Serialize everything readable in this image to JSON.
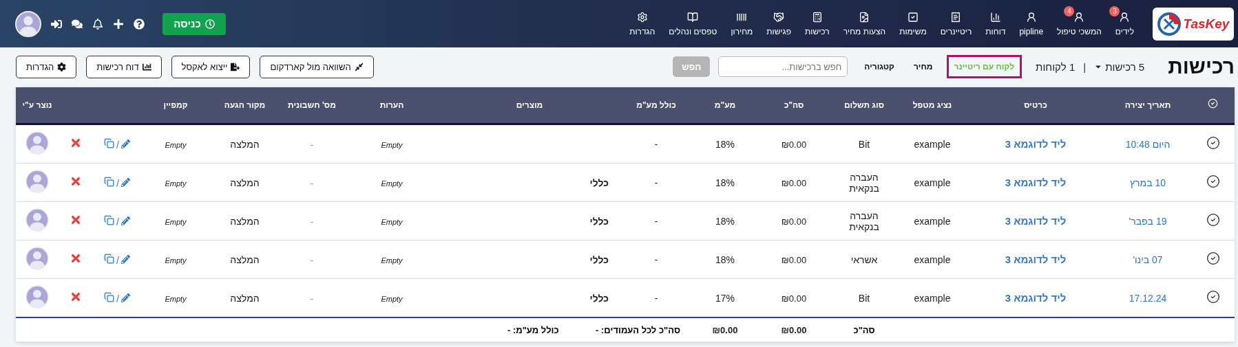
{
  "header": {
    "logo": {
      "text": "TasKey"
    },
    "nav": [
      {
        "label": "לידים",
        "badge": "3"
      },
      {
        "label": "המשכי טיפול",
        "badge": "4"
      },
      {
        "label": "pipline"
      },
      {
        "label": "דוחות"
      },
      {
        "label": "ריטיינרים"
      },
      {
        "label": "משימות"
      },
      {
        "label": "הצעות מחיר"
      },
      {
        "label": "רכישות"
      },
      {
        "label": "פגישות"
      },
      {
        "label": "מחירון"
      },
      {
        "label": "טפסים ונהלים"
      },
      {
        "label": "הגדרות"
      }
    ],
    "checkin_button": {
      "label": "כניסה"
    }
  },
  "page": {
    "title": "רכישות",
    "purchases_count": "5 רכישות",
    "separator": "|",
    "clients_count": "1 לקוחות",
    "filters": [
      {
        "label": "לקוח עם ריטיינר",
        "selected": true
      },
      {
        "label": "מחיר",
        "selected": false
      },
      {
        "label": "קטגוריה",
        "selected": false
      }
    ],
    "search": {
      "placeholder": "חפש ברכישות...",
      "button": "חפש",
      "button_disabled": true
    },
    "actions": [
      {
        "label": "השוואה מול קארדקום"
      },
      {
        "label": "ייצוא לאקסל"
      },
      {
        "label": "דוח רכישות"
      },
      {
        "label": "הגדרות"
      }
    ]
  },
  "table": {
    "columns": [
      {
        "kind": "select"
      },
      {
        "kind": "text",
        "label": "תאריך יצירה"
      },
      {
        "kind": "text",
        "label": "כרטיס"
      },
      {
        "kind": "text",
        "label": "נציג מטפל"
      },
      {
        "kind": "text",
        "label": "סוג תשלום"
      },
      {
        "kind": "text",
        "label": "סה\"כ"
      },
      {
        "kind": "text",
        "label": "מע\"מ"
      },
      {
        "kind": "text",
        "label": "כולל מע\"מ"
      },
      {
        "kind": "text",
        "label": "מוצרים"
      },
      {
        "kind": "text",
        "label": "הערות"
      },
      {
        "kind": "text",
        "label": "מס' חשבונית"
      },
      {
        "kind": "text",
        "label": "מקור הגעה"
      },
      {
        "kind": "text",
        "label": "קמפיין"
      },
      {
        "kind": "blank"
      },
      {
        "kind": "blank"
      },
      {
        "kind": "text",
        "label": "נוצר ע\"י"
      }
    ],
    "rows": [
      {
        "date": "היום 10:48",
        "card": "ליד לדוגמא 3",
        "rep": "example",
        "payment": "Bit",
        "total": "₪0.00",
        "vat": "18%",
        "incl": "-",
        "notes": "Empty",
        "invoice": "-",
        "source": "המלצה",
        "campaign": "Empty",
        "separator": "/"
      },
      {
        "date": "10 במרץ",
        "card": "ליד לדוגמא 3",
        "rep": "example",
        "payment": "העברה בנקאית",
        "total": "₪0.00",
        "vat": "18%",
        "incl": "-",
        "products": "כללי",
        "notes": "Empty",
        "invoice": "-",
        "source": "המלצה",
        "campaign": "Empty",
        "separator": "/"
      },
      {
        "date": "19 בפבר'",
        "card": "ליד לדוגמא 3",
        "rep": "example",
        "payment": "העברה בנקאית",
        "total": "₪0.00",
        "vat": "18%",
        "incl": "-",
        "products": "כללי",
        "notes": "Empty",
        "invoice": "-",
        "source": "המלצה",
        "campaign": "Empty",
        "separator": "/"
      },
      {
        "date": "07 בינו'",
        "card": "ליד לדוגמא 3",
        "rep": "example",
        "payment": "אשראי",
        "total": "₪0.00",
        "vat": "18%",
        "incl": "-",
        "products": "כללי",
        "notes": "Empty",
        "invoice": "-",
        "source": "המלצה",
        "campaign": "Empty",
        "separator": "/"
      },
      {
        "date": "17.12.24",
        "card": "ליד לדוגמא 3",
        "rep": "example",
        "payment": "Bit",
        "total": "₪0.00",
        "vat": "17%",
        "incl": "-",
        "products": "כללי",
        "notes": "Empty",
        "invoice": "-",
        "source": "המלצה",
        "campaign": "Empty",
        "separator": "/"
      }
    ],
    "footer": {
      "payment": "סה\"כ",
      "total": "₪0.00",
      "vat": "₪0.00",
      "incl": "סה\"כ לכל העמודים: -",
      "products": "כולל מע\"מ: -"
    }
  }
}
